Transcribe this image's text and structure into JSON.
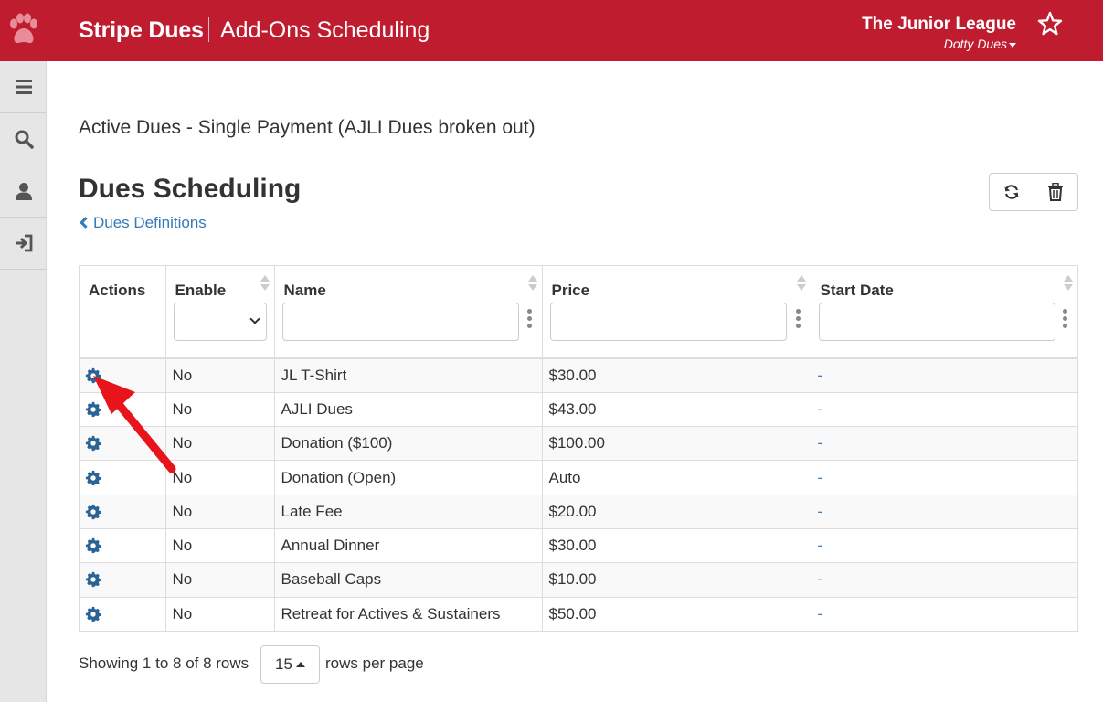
{
  "header": {
    "brand": "Stripe Dues",
    "page_name": "Add-Ons Scheduling",
    "org_name": "The Junior League",
    "user_name": "Dotty Dues",
    "accent_color": "#c01c30",
    "icons": [
      "paw-icon",
      "star-icon"
    ]
  },
  "sidebar": {
    "items": [
      {
        "name": "menu",
        "icon": "hamburger-icon"
      },
      {
        "name": "search",
        "icon": "search-icon"
      },
      {
        "name": "profile",
        "icon": "user-icon"
      },
      {
        "name": "logout",
        "icon": "sign-in-icon"
      }
    ]
  },
  "main": {
    "subtitle": "Active Dues - Single Payment (AJLI Dues broken out)",
    "heading": "Dues Scheduling",
    "back_link": "Dues Definitions",
    "toolbar": {
      "refresh_icon": "refresh-icon",
      "delete_icon": "trash-icon"
    }
  },
  "table": {
    "columns": [
      "Actions",
      "Enable",
      "Name",
      "Price",
      "Start Date"
    ],
    "filters": {
      "enable": "",
      "name": "",
      "price": "",
      "start_date": ""
    },
    "rows": [
      {
        "enable": "No",
        "name": "JL T-Shirt",
        "price": "$30.00",
        "start_date": "-"
      },
      {
        "enable": "No",
        "name": "AJLI Dues",
        "price": "$43.00",
        "start_date": "-"
      },
      {
        "enable": "No",
        "name": "Donation ($100)",
        "price": "$100.00",
        "start_date": "-"
      },
      {
        "enable": "No",
        "name": "Donation (Open)",
        "price": "Auto",
        "start_date": "-"
      },
      {
        "enable": "No",
        "name": "Late Fee",
        "price": "$20.00",
        "start_date": "-"
      },
      {
        "enable": "No",
        "name": "Annual Dinner",
        "price": "$30.00",
        "start_date": "-"
      },
      {
        "enable": "No",
        "name": "Baseball Caps",
        "price": "$10.00",
        "start_date": "-"
      },
      {
        "enable": "No",
        "name": "Retreat for Actives & Sustainers",
        "price": "$50.00",
        "start_date": "-"
      }
    ]
  },
  "pagination": {
    "info": "Showing 1 to 8 of 8 rows",
    "page_size": "15",
    "rows_per_page": "rows per page"
  }
}
